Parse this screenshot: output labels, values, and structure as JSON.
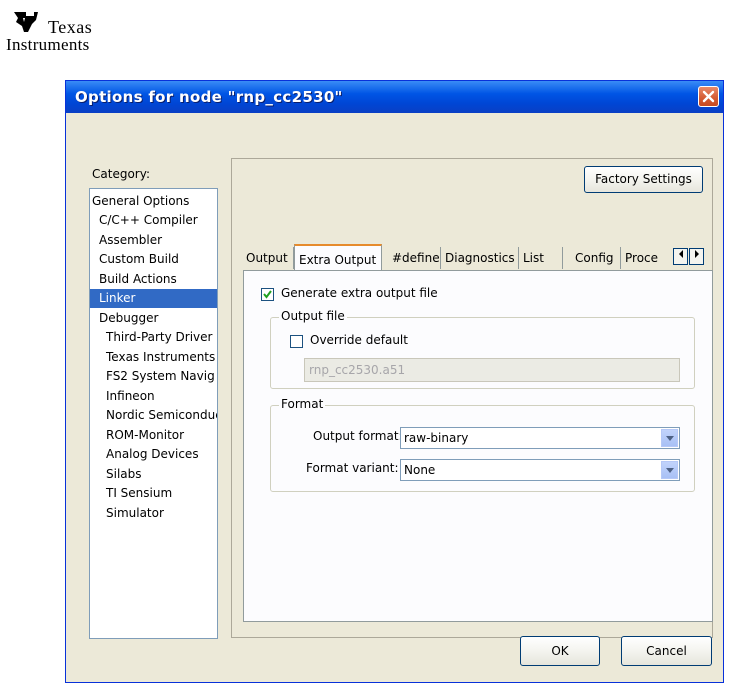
{
  "logo": {
    "line1": "Texas",
    "line2": "Instruments"
  },
  "dialog": {
    "title": "Options for node \"rnp_cc2530\"",
    "category_label": "Category:",
    "categories": [
      "General Options",
      "C/C++ Compiler",
      "Assembler",
      "Custom Build",
      "Build Actions",
      "Linker",
      "Debugger",
      "Third-Party Driver",
      "Texas Instruments",
      "FS2 System Navig",
      "Infineon",
      "Nordic Semiconduc",
      "ROM-Monitor",
      "Analog Devices",
      "Silabs",
      "TI Sensium",
      "Simulator"
    ],
    "selected_category": "Linker",
    "factory_settings_label": "Factory Settings",
    "tabs": [
      "Output",
      "Extra Output",
      "#define",
      "Diagnostics",
      "List",
      "Config",
      "Proce"
    ],
    "active_tab": "Extra Output",
    "generate_extra_output": {
      "label": "Generate extra output file",
      "checked": true
    },
    "output_file_group": {
      "title": "Output file",
      "override_default": {
        "label": "Override default",
        "checked": false
      },
      "filename": "rnp_cc2530.a51"
    },
    "format_group": {
      "title": "Format",
      "output_format_label": "Output format:",
      "output_format_value": "raw-binary",
      "format_variant_label": "Format variant:",
      "format_variant_value": "None"
    },
    "ok_label": "OK",
    "cancel_label": "Cancel"
  },
  "colors": {
    "titlebar": "#0055e5",
    "dialog_bg": "#ece9d8",
    "selection": "#316ac5",
    "close_button": "#d45a32",
    "active_tab_accent": "#e68b2c"
  }
}
